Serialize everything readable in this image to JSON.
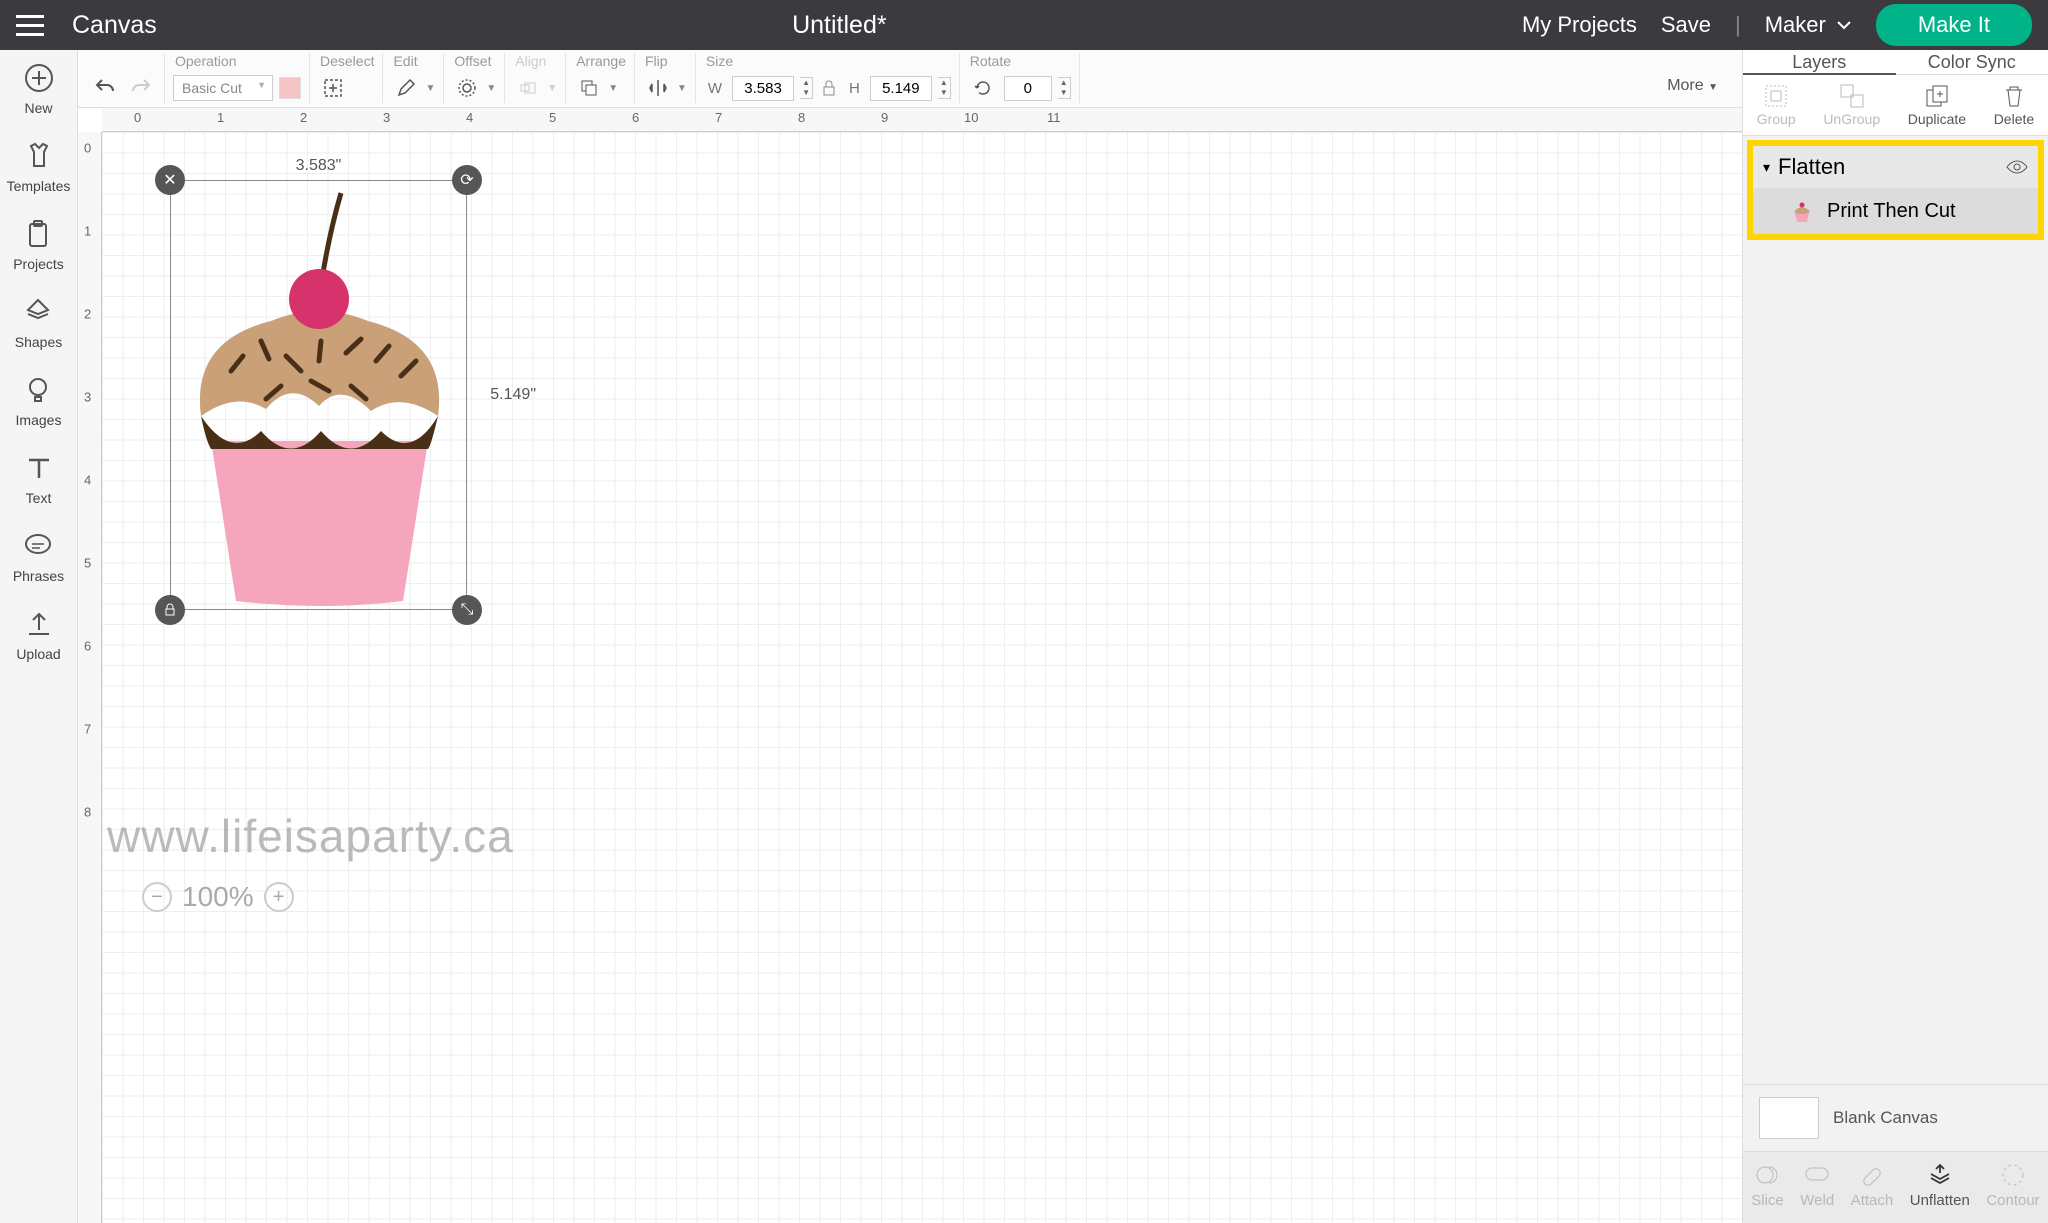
{
  "topbar": {
    "app_name": "Canvas",
    "doc_title": "Untitled*",
    "my_projects": "My Projects",
    "save": "Save",
    "machine": "Maker",
    "make_it": "Make It"
  },
  "leftnav": [
    {
      "label": "New"
    },
    {
      "label": "Templates"
    },
    {
      "label": "Projects"
    },
    {
      "label": "Shapes"
    },
    {
      "label": "Images"
    },
    {
      "label": "Text"
    },
    {
      "label": "Phrases"
    },
    {
      "label": "Upload"
    }
  ],
  "toolbar": {
    "undo_redo": "",
    "operation": {
      "head": "Operation",
      "value": "Basic Cut"
    },
    "deselect": "Deselect",
    "edit": "Edit",
    "offset": "Offset",
    "align": "Align",
    "arrange": "Arrange",
    "flip": "Flip",
    "size": {
      "head": "Size",
      "w_label": "W",
      "w": "3.583",
      "h_label": "H",
      "h": "5.149"
    },
    "rotate": {
      "head": "Rotate",
      "value": "0"
    },
    "more": "More"
  },
  "ruler_h": [
    "0",
    "1",
    "2",
    "3",
    "4",
    "5",
    "6",
    "7",
    "8",
    "9",
    "10",
    "11"
  ],
  "ruler_v": [
    "0",
    "1",
    "2",
    "3",
    "4",
    "5",
    "6",
    "7",
    "8"
  ],
  "selection": {
    "w_label": "3.583\"",
    "h_label": "5.149\""
  },
  "watermark": "www.lifeisaparty.ca",
  "zoom": "100%",
  "rightpanel": {
    "tabs": {
      "layers": "Layers",
      "colorsync": "Color Sync"
    },
    "actions": {
      "group": "Group",
      "ungroup": "UnGroup",
      "duplicate": "Duplicate",
      "delete": "Delete"
    },
    "layer_group": "Flatten",
    "layer_item": "Print Then Cut",
    "blank": "Blank Canvas",
    "bottom": {
      "slice": "Slice",
      "weld": "Weld",
      "attach": "Attach",
      "unflatten": "Unflatten",
      "contour": "Contour"
    }
  }
}
